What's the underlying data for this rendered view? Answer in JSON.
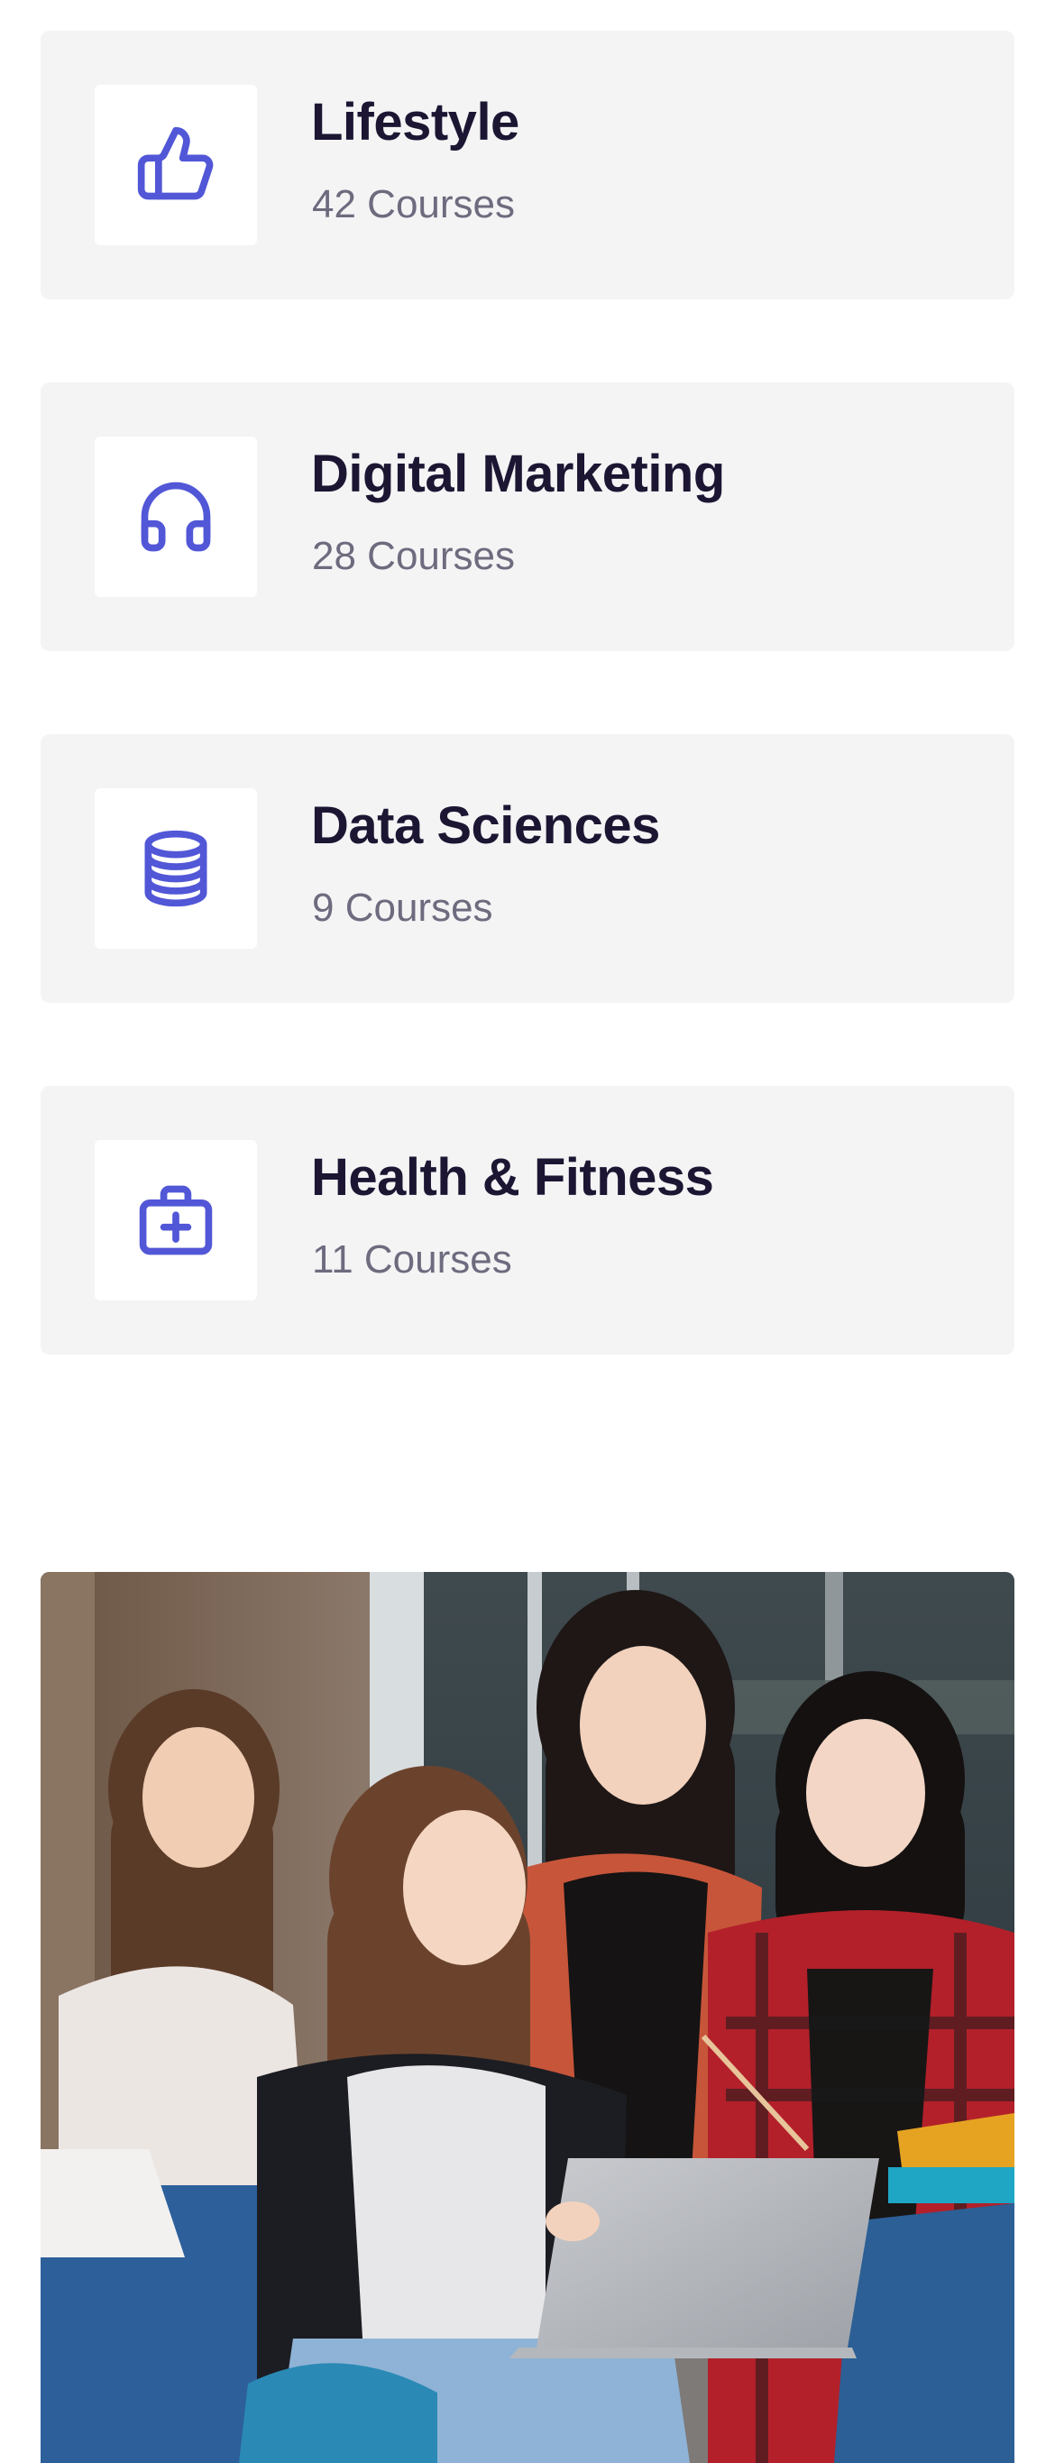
{
  "categories": [
    {
      "title": "Lifestyle",
      "count": "42 Courses",
      "icon": "thumbs-up-icon"
    },
    {
      "title": "Digital Marketing",
      "count": "28 Courses",
      "icon": "headphones-icon"
    },
    {
      "title": "Data Sciences",
      "count": "9 Courses",
      "icon": "database-icon"
    },
    {
      "title": "Health & Fitness",
      "count": "11 Courses",
      "icon": "first-aid-kit-icon"
    }
  ],
  "colors": {
    "card_background": "#f4f4f5",
    "icon_accent": "#5157d6",
    "title_text": "#1c1633",
    "count_text": "#6d6b7e"
  },
  "hero_image": {
    "subject": "photo-students-with-laptop"
  }
}
